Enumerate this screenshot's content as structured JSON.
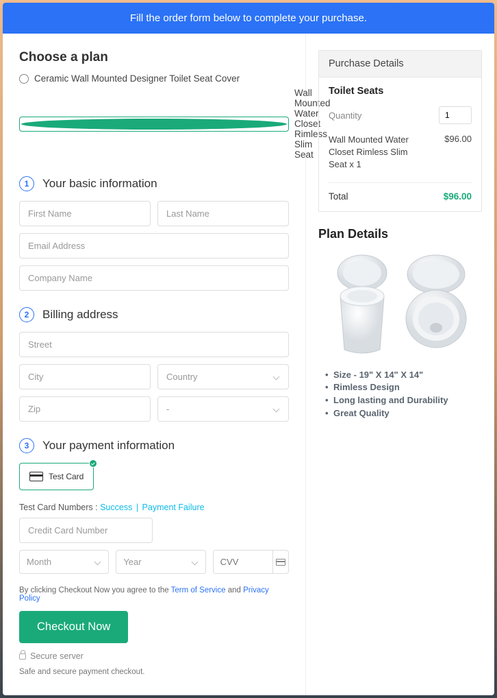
{
  "banner": "Fill the order form below to complete your purchase.",
  "choose": {
    "heading": "Choose a plan",
    "options": [
      "Ceramic Wall Mounted Designer Toilet Seat Cover",
      "Wall Mounted Water Closet Rimless Slim Seat"
    ]
  },
  "sec1": {
    "num": "1",
    "title": "Your basic information"
  },
  "fields": {
    "first": "First Name",
    "last": "Last Name",
    "email": "Email Address",
    "company": "Company Name"
  },
  "sec2": {
    "num": "2",
    "title": "Billing address"
  },
  "billing": {
    "street": "Street",
    "city": "City",
    "country": "Country",
    "zip": "Zip",
    "state": "-"
  },
  "sec3": {
    "num": "3",
    "title": "Your payment information"
  },
  "testCard": "Test  Card",
  "tcn": {
    "label": "Test Card Numbers : ",
    "success": "Success",
    "fail": "Payment Failure"
  },
  "cc": {
    "num": "Credit Card Number",
    "month": "Month",
    "year": "Year",
    "cvv": "CVV"
  },
  "agree": {
    "pre": "By clicking Checkout Now you agree to the ",
    "tos": "Term of Service",
    "and": " and ",
    "pp": "Privacy Policy"
  },
  "checkout": "Checkout Now",
  "secure": "Secure server",
  "safe": "Safe and secure payment checkout.",
  "purchase": {
    "head": "Purchase Details",
    "cat": "Toilet Seats",
    "qtyLabel": "Quantity",
    "qty": "1",
    "itemName": "Wall Mounted Water Closet Rimless Slim Seat x 1",
    "itemPrice": "$96.00",
    "totalLabel": "Total",
    "total": "$96.00"
  },
  "planDetails": {
    "title": "Plan Details",
    "bullets": [
      "Size - 19\" X 14\" X 14\"",
      "Rimless Design",
      "Long lasting and Durability",
      "Great Quality"
    ]
  }
}
